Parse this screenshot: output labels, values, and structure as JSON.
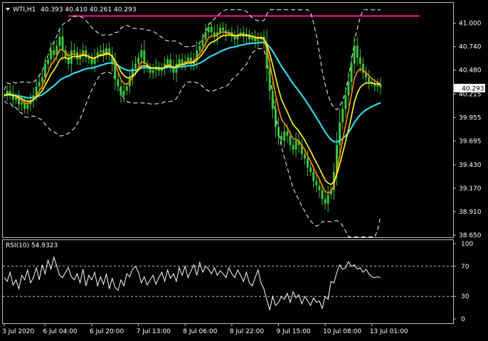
{
  "header": {
    "symbol": "WTI,H1",
    "ohlc": "40.393 40.410 40.261 40.293"
  },
  "current_price": "40.293",
  "colors": {
    "background": "#000000",
    "frame": "#c0c0c0",
    "price_candles": "#3ec23e",
    "ma_fast": "#ff8c00",
    "ma_mid": "#ffff33",
    "ma_slow": "#33d6e6",
    "envelope": "#ffffff",
    "resistance": "#ff1493",
    "rsi_line": "#ffffff",
    "price_tag_bg": "#ffffff",
    "price_tag_text": "#000000"
  },
  "chart_data": [
    {
      "type": "line",
      "pane": "main",
      "title": "WTI,H1",
      "ylim": [
        38.65,
        41.1
      ],
      "y_ticks": [
        "41.000",
        "40.740",
        "40.480",
        "40.215",
        "39.955",
        "39.695",
        "39.430",
        "39.170",
        "38.910",
        "38.650"
      ],
      "y_tick_values": [
        41.0,
        40.74,
        40.48,
        40.215,
        39.955,
        39.695,
        39.43,
        39.17,
        38.91,
        38.65
      ],
      "x_ticks": [
        "3 Jul 2020",
        "6 Jul 04:00",
        "6 Jul 20:00",
        "7 Jul 13:00",
        "8 Jul 06:00",
        "8 Jul 22:00",
        "9 Jul 15:00",
        "10 Jul 08:00",
        "13 Jul 01:00"
      ],
      "x_tick_index": [
        0,
        14,
        30,
        46,
        62,
        78,
        94,
        110,
        126
      ],
      "n_bars": 130,
      "resistance_level": 41.08,
      "resistance_start_index": 22,
      "series": [
        {
          "role": "close",
          "values": [
            40.2,
            40.25,
            40.22,
            40.15,
            40.18,
            40.1,
            40.12,
            40.05,
            40.1,
            40.15,
            40.2,
            40.3,
            40.35,
            40.4,
            40.55,
            40.6,
            40.7,
            40.65,
            40.75,
            40.85,
            40.7,
            40.62,
            40.55,
            40.7,
            40.68,
            40.6,
            40.65,
            40.7,
            40.62,
            40.6,
            40.55,
            40.62,
            40.68,
            40.7,
            40.65,
            40.72,
            40.65,
            40.55,
            40.38,
            40.3,
            40.2,
            40.25,
            40.3,
            40.4,
            40.5,
            40.55,
            40.62,
            40.7,
            40.55,
            40.5,
            40.45,
            40.48,
            40.52,
            40.47,
            40.5,
            40.55,
            40.6,
            40.52,
            40.45,
            40.55,
            40.6,
            40.55,
            40.58,
            40.62,
            40.55,
            40.6,
            40.7,
            40.75,
            40.82,
            40.9,
            40.96,
            40.9,
            40.85,
            40.9,
            40.95,
            40.92,
            40.88,
            40.9,
            40.85,
            40.82,
            40.88,
            40.9,
            40.85,
            40.88,
            40.82,
            40.85,
            40.8,
            40.82,
            40.85,
            40.78,
            40.5,
            40.25,
            40.05,
            39.85,
            39.75,
            39.7,
            39.8,
            39.75,
            39.65,
            39.6,
            39.7,
            39.65,
            39.55,
            39.5,
            39.4,
            39.35,
            39.25,
            39.2,
            39.15,
            39.05,
            39.0,
            39.1,
            39.15,
            39.35,
            39.65,
            39.9,
            40.05,
            40.2,
            40.35,
            40.55,
            40.75,
            40.62,
            40.55,
            40.45,
            40.4,
            40.35,
            40.33,
            40.3,
            40.32,
            40.29
          ]
        },
        {
          "role": "ma_fast",
          "name": ""
        },
        {
          "role": "ma_mid",
          "name": ""
        },
        {
          "role": "ma_slow",
          "name": ""
        },
        {
          "role": "envelope",
          "name": ""
        }
      ]
    },
    {
      "type": "line",
      "pane": "indicator",
      "title": "RSI(10) 54.9323",
      "ylim": [
        0,
        100
      ],
      "y_ticks": [
        "100",
        "70",
        "30",
        "0"
      ],
      "y_tick_values": [
        100,
        70,
        30,
        0
      ],
      "levels": [
        70,
        30
      ],
      "series": [
        {
          "role": "rsi",
          "values": [
            55,
            50,
            62,
            45,
            52,
            40,
            58,
            52,
            65,
            48,
            55,
            68,
            52,
            72,
            60,
            78,
            66,
            82,
            70,
            58,
            55,
            62,
            68,
            56,
            52,
            60,
            48,
            66,
            44,
            58,
            52,
            62,
            44,
            56,
            46,
            60,
            40,
            54,
            42,
            38,
            52,
            44,
            60,
            56,
            66,
            70,
            62,
            48,
            56,
            45,
            52,
            58,
            46,
            55,
            62,
            50,
            65,
            54,
            60,
            50,
            68,
            58,
            70,
            55,
            64,
            72,
            58,
            75,
            62,
            70,
            66,
            60,
            68,
            58,
            64,
            60,
            55,
            68,
            60,
            55,
            65,
            58,
            50,
            62,
            48,
            44,
            55,
            65,
            48,
            40,
            25,
            12,
            30,
            18,
            22,
            30,
            26,
            34,
            22,
            36,
            28,
            32,
            20,
            30,
            24,
            18,
            28,
            22,
            24,
            14,
            30,
            26,
            50,
            48,
            62,
            72,
            66,
            68,
            76,
            70,
            72,
            66,
            68,
            62,
            66,
            60,
            56,
            55,
            56,
            55
          ]
        }
      ]
    }
  ]
}
